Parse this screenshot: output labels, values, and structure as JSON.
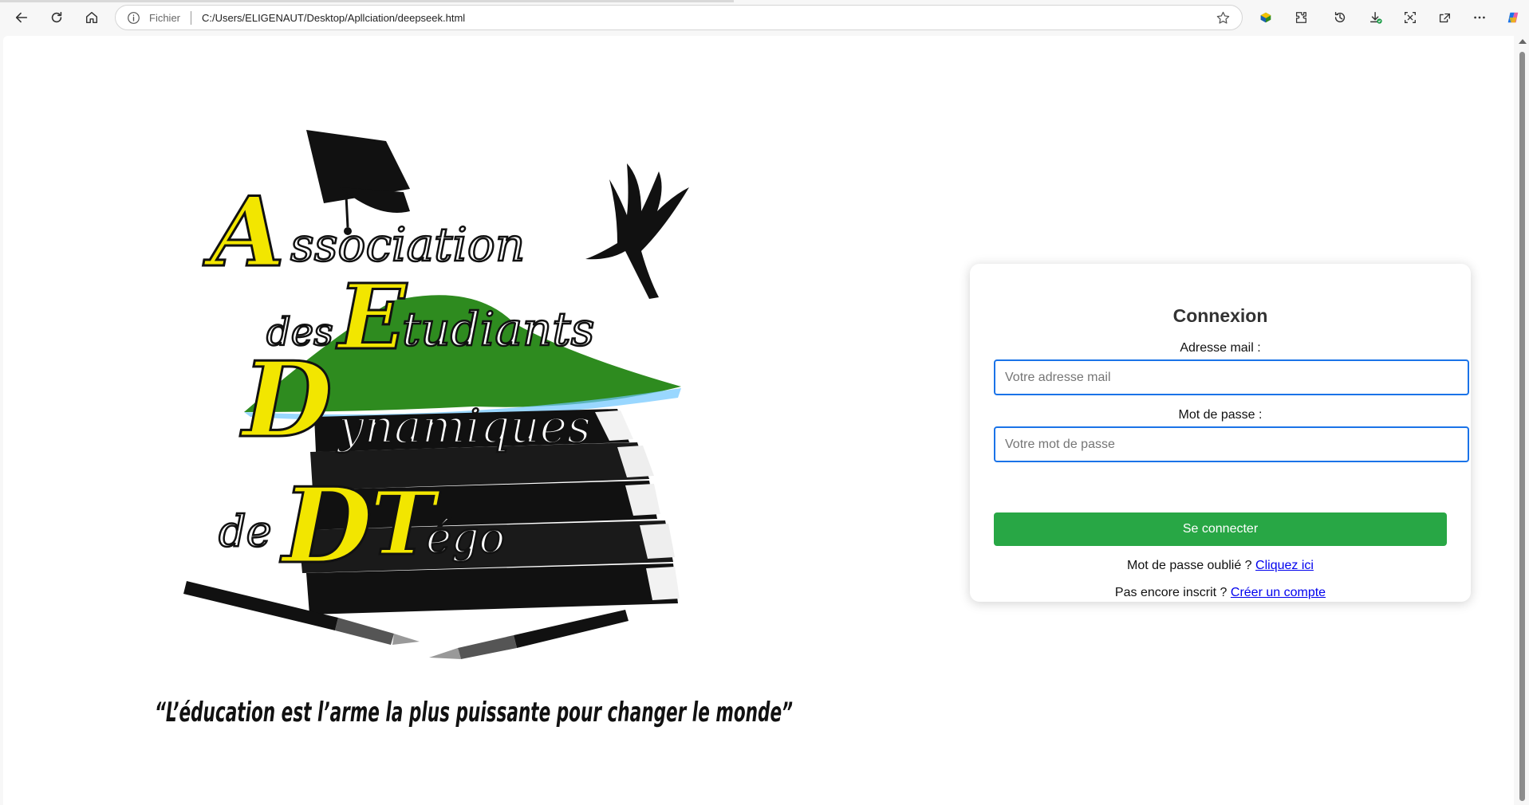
{
  "browser": {
    "file_label": "Fichier",
    "url": "C:/Users/ELIGENAUT/Desktop/Apllciation/deepseek.html"
  },
  "logo": {
    "line1": "Association",
    "line2": "des Etudiants",
    "line3": "Dynamiques",
    "line4": "de DTégo",
    "motto": "“L’éducation est l’arme la plus puissante pour changer le monde”"
  },
  "login": {
    "title": "Connexion",
    "email_label": "Adresse mail :",
    "email_placeholder": "Votre adresse mail",
    "email_value": "",
    "password_label": "Mot de passe :",
    "password_placeholder": "Votre mot de passe",
    "password_value": "",
    "submit_label": "Se connecter",
    "forgot_text": "Mot de passe oublié ?",
    "forgot_link": "Cliquez ici",
    "register_text": "Pas encore inscrit ?",
    "register_link": "Créer un compte"
  },
  "colors": {
    "accent": "#1a73e8",
    "submit": "#28a745",
    "link": "#0000ee",
    "logo_yellow": "#f2e600",
    "logo_green": "#2e8b1f"
  }
}
